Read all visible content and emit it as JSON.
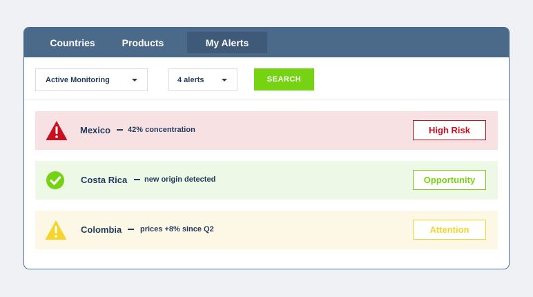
{
  "nav": {
    "tabs": [
      {
        "label": "Countries"
      },
      {
        "label": "Products"
      },
      {
        "label": "My Alerts",
        "active": true
      }
    ]
  },
  "controls": {
    "monitor_select": "Active Monitoring",
    "alerts_select": "4 alerts",
    "search_label": "SEARCH"
  },
  "alerts": [
    {
      "icon": "warning-triangle-icon",
      "country": "Mexico",
      "detail": "42% concentration",
      "badge": "High Risk",
      "color": "#c8101e"
    },
    {
      "icon": "check-circle-icon",
      "country": "Costa Rica",
      "detail": "new origin detected",
      "badge": "Opportunity",
      "color": "#76d312"
    },
    {
      "icon": "warning-triangle-icon",
      "country": "Colombia",
      "detail": "prices +8% since Q2",
      "badge": "Attention",
      "color": "#f6d52b"
    }
  ],
  "colors": {
    "nav_bg": "#4b6a8a",
    "nav_active_bg": "#3e5a78",
    "accent_green": "#76d312",
    "text_navy": "#1f3a5c",
    "page_bg": "#eff1f4"
  }
}
